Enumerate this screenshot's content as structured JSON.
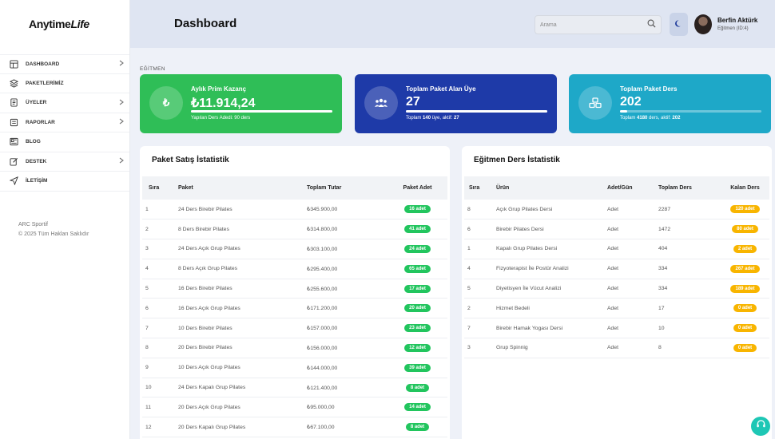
{
  "brand": {
    "part1": "Anytime",
    "part2": "Life"
  },
  "sidebar": {
    "items": [
      {
        "label": "DASHBOARD",
        "icon": "dashboard-icon",
        "has_chevron": true
      },
      {
        "label": "PAKETLERİMİZ",
        "icon": "layers-icon",
        "has_chevron": false
      },
      {
        "label": "ÜYELER",
        "icon": "document-icon",
        "has_chevron": true
      },
      {
        "label": "RAPORLAR",
        "icon": "report-icon",
        "has_chevron": true
      },
      {
        "label": "BLOG",
        "icon": "newspaper-icon",
        "has_chevron": false
      },
      {
        "label": "DESTEK",
        "icon": "edit-icon",
        "has_chevron": true
      },
      {
        "label": "İLETİŞİM",
        "icon": "send-icon",
        "has_chevron": false
      }
    ],
    "footer_line1": "ARC Sportif",
    "footer_line2": "© 2025 Tüm Hakları Saklıdır"
  },
  "header": {
    "title": "Dashboard",
    "search_placeholder": "Arama",
    "user_name": "Berfin Aktürk",
    "user_role": "Eğitmen (ID:4)"
  },
  "section_label": "EĞİTMEN",
  "cards": [
    {
      "title": "Aylık Prim Kazanç",
      "value": "₺11.914,24",
      "icon": "₺",
      "progress": 1.0,
      "sub": "Yapılan Ders Adedi: 90 ders",
      "color": "#2fbe57"
    },
    {
      "title": "Toplam Paket Alan Üye",
      "value": "27",
      "icon": "group-icon",
      "progress": 1.0,
      "sub_pre": "Toplam ",
      "sub_b1": "140",
      "sub_mid": " üye, aktif: ",
      "sub_b2": "27",
      "color": "#1e3aa8"
    },
    {
      "title": "Toplam Paket Ders",
      "value": "202",
      "icon": "cubes-icon",
      "progress": 0.05,
      "sub_pre": "Toplam ",
      "sub_b1": "4180",
      "sub_mid": " ders, aktif: ",
      "sub_b2": "202",
      "color": "#1ea8c8"
    }
  ],
  "paket": {
    "title": "Paket Satış İstatistik",
    "headers": [
      "Sıra",
      "Paket",
      "Toplam Tutar",
      "Paket Adet"
    ],
    "rows": [
      [
        "1",
        "24 Ders Birebir Pilates",
        "₺345.900,00",
        "16 adet"
      ],
      [
        "2",
        "8 Ders Birebir Pilates",
        "₺314.800,00",
        "41 adet"
      ],
      [
        "3",
        "24 Ders Açık Grup Pilates",
        "₺303.100,00",
        "24 adet"
      ],
      [
        "4",
        "8 Ders Açık Grup Pilates",
        "₺295.400,00",
        "65 adet"
      ],
      [
        "5",
        "16 Ders Birebir Pilates",
        "₺255.600,00",
        "17 adet"
      ],
      [
        "6",
        "16 Ders Açık Grup Pilates",
        "₺171.200,00",
        "20 adet"
      ],
      [
        "7",
        "10 Ders Birebir Pilates",
        "₺157.000,00",
        "23 adet"
      ],
      [
        "8",
        "20 Ders Birebir Pilates",
        "₺156.000,00",
        "12 adet"
      ],
      [
        "9",
        "10 Ders Açık Grup Pilates",
        "₺144.000,00",
        "39 adet"
      ],
      [
        "10",
        "24 Ders Kapalı Grup Pilates",
        "₺121.400,00",
        "8 adet"
      ],
      [
        "11",
        "20 Ders Açık Grup Pilates",
        "₺95.000,00",
        "14 adet"
      ],
      [
        "12",
        "20 Ders Kapalı Grup Pilates",
        "₺67.100,00",
        "8 adet"
      ]
    ]
  },
  "egitmen": {
    "title": "Eğitmen Ders İstatistik",
    "headers": [
      "Sıra",
      "Ürün",
      "Adet/Gün",
      "Toplam Ders",
      "Kalan Ders"
    ],
    "rows": [
      [
        "8",
        "Açık Grup Pilates Dersi",
        "Adet",
        "2287",
        "120 adet"
      ],
      [
        "6",
        "Birebir Pilates Dersi",
        "Adet",
        "1472",
        "80 adet"
      ],
      [
        "1",
        "Kapalı Grup Pilates Dersi",
        "Adet",
        "404",
        "2 adet"
      ],
      [
        "4",
        "Fizyoterapist İle Postür Analizi",
        "Adet",
        "334",
        "267 adet"
      ],
      [
        "5",
        "Diyetisyen İle Vücut Analizi",
        "Adet",
        "334",
        "189 adet"
      ],
      [
        "2",
        "Hizmet Bedeli",
        "Adet",
        "17",
        "0 adet"
      ],
      [
        "7",
        "Birebir Hamak Yogası Dersi",
        "Adet",
        "10",
        "0 adet"
      ],
      [
        "3",
        "Grup Spinnig",
        "Adet",
        "8",
        "0 adet"
      ]
    ]
  }
}
